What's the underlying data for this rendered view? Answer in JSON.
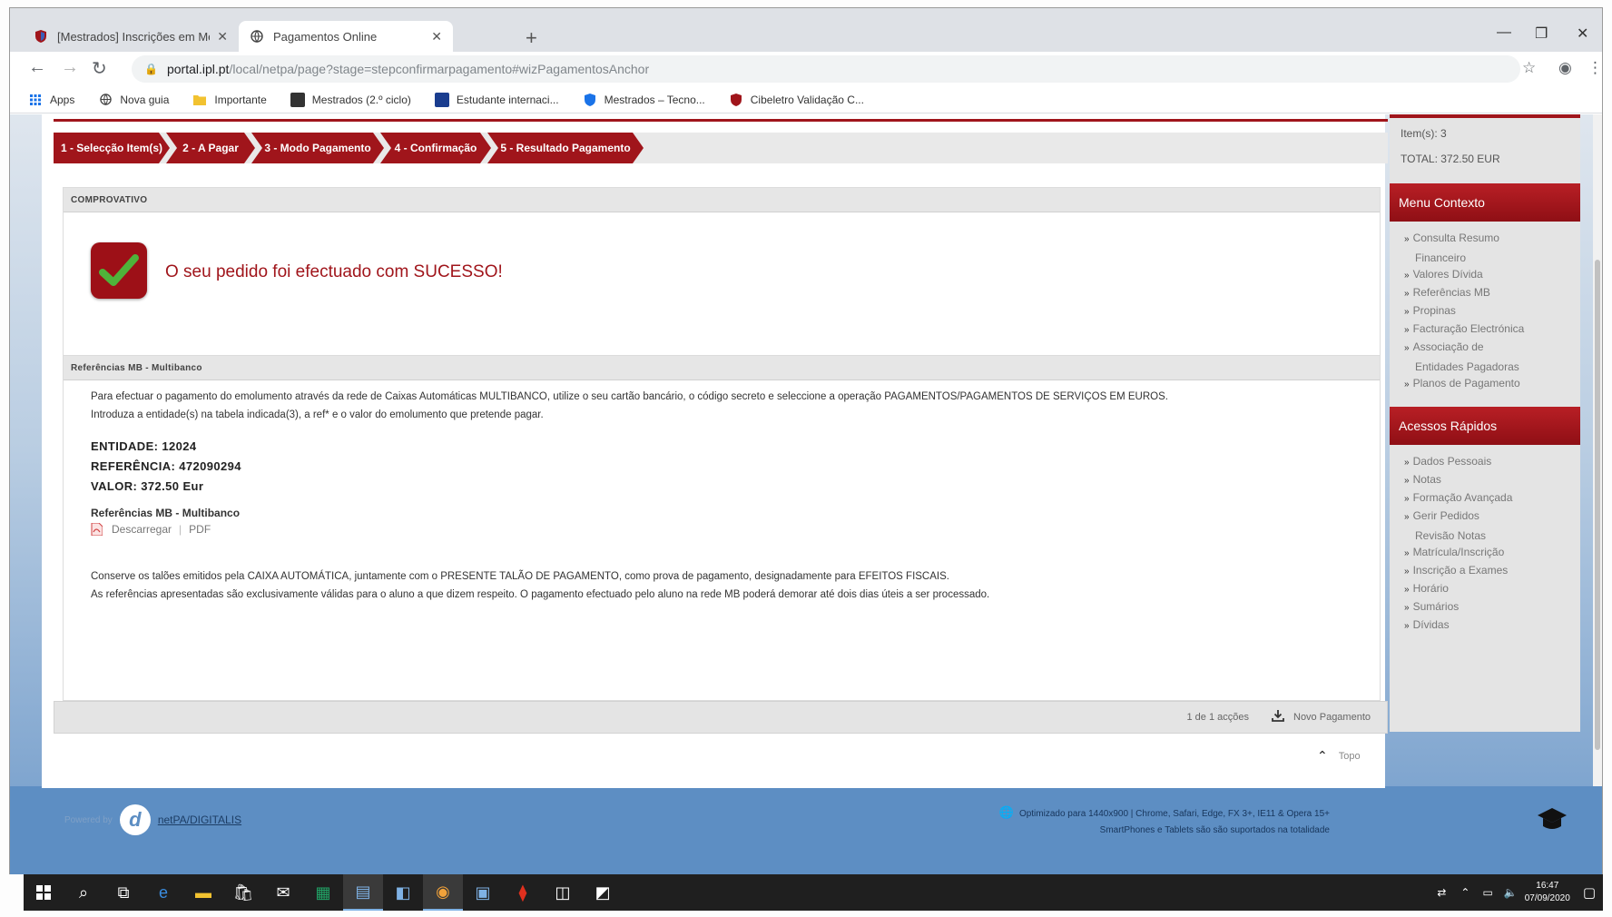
{
  "browser": {
    "tabs": [
      {
        "label": "[Mestrados] Inscrições em Mes…",
        "favicon": "shield-icon",
        "active": false
      },
      {
        "label": "Pagamentos Online",
        "favicon": "globe-icon",
        "active": true
      }
    ],
    "url_host": "portal.ipl.pt",
    "url_path": "/local/netpa/page?stage=stepconfirmarpagamento#wizPagamentosAnchor",
    "bookmarks": [
      {
        "label": "Apps",
        "icon": "apps-grid-icon",
        "color": "#1a73e8"
      },
      {
        "label": "Nova guia",
        "icon": "globe-icon",
        "color": "#555555"
      },
      {
        "label": "Importante",
        "icon": "folder-icon",
        "color": "#f2c230"
      },
      {
        "label": "Mestrados (2.º ciclo)",
        "icon": "bookmark-icon",
        "color": "#333333"
      },
      {
        "label": "Estudante internaci...",
        "icon": "bookmark-icon",
        "color": "#1a3d8f"
      },
      {
        "label": "Mestrados – Tecno...",
        "icon": "shield-icon",
        "color": "#1a73e8"
      },
      {
        "label": "Cibeletro Validação C...",
        "icon": "shield-icon",
        "color": "#a0151b"
      }
    ]
  },
  "wizard": {
    "steps": [
      "1 - Selecção Item(s)",
      "2 - A Pagar",
      "3 - Modo Pagamento",
      "4 - Confirmação",
      "5 - Resultado Pagamento"
    ]
  },
  "comprovativo": {
    "header": "COMPROVATIVO",
    "message": "O seu pedido foi efectuado com SUCESSO!"
  },
  "multibanco": {
    "header": "Referências MB - Multibanco",
    "instruction_line1": "Para efectuar o pagamento do emolumento através da rede de Caixas Automáticas MULTIBANCO, utilize o seu cartão bancário, o código secreto e seleccione a operação PAGAMENTOS/PAGAMENTOS DE SERVIÇOS EM EUROS.",
    "instruction_line2": "Introduza a entidade(s) na tabela indicada(3), a ref* e o valor do emolumento que pretende pagar.",
    "entidade": "ENTIDADE: 12024",
    "referencia": "REFERÊNCIA: 472090294",
    "valor": "VALOR: 372.50 Eur",
    "sublabel": "Referências MB - Multibanco",
    "download_label": "Descarregar",
    "format_label": "PDF",
    "note_line1": "Conserve os talões emitidos pela CAIXA AUTOMÁTICA, juntamente com o PRESENTE TALÃO DE PAGAMENTO, como prova de pagamento, designadamente para EFEITOS FISCAIS.",
    "note_line2": "As referências apresentadas são exclusivamente válidas para o aluno a que dizem respeito. O pagamento efectuado pelo aluno na rede MB poderá demorar até dois dias úteis a ser processado."
  },
  "actions": {
    "count_label": "1 de 1 acções",
    "new_payment": "Novo Pagamento",
    "top_link": "Topo"
  },
  "sidebar": {
    "items_count": "Item(s): 3",
    "total": "TOTAL: 372.50 EUR",
    "menu_header": "Menu Contexto",
    "menu_items": [
      [
        "Consulta Resumo",
        "Financeiro"
      ],
      [
        "Valores Dívida"
      ],
      [
        "Referências MB"
      ],
      [
        "Propinas"
      ],
      [
        "Facturação Electrónica"
      ],
      [
        "Associação de",
        "Entidades Pagadoras"
      ],
      [
        "Planos de Pagamento"
      ]
    ],
    "quick_header": "Acessos Rápidos",
    "quick_items": [
      [
        "Dados Pessoais"
      ],
      [
        "Notas"
      ],
      [
        "Formação Avançada"
      ],
      [
        "Gerir Pedidos",
        "Revisão Notas"
      ],
      [
        "Matrícula/Inscrição"
      ],
      [
        "Inscrição a Exames"
      ],
      [
        "Horário"
      ],
      [
        "Sumários"
      ],
      [
        "Dívidas"
      ]
    ]
  },
  "footer": {
    "powered_label": "Powered by",
    "brand": "netPA/DIGITALIS",
    "note_line1": "Optimizado para 1440x900 | Chrome, Safari, Edge, FX 3+, IE11 & Opera 15+",
    "note_line2": "SmartPhones e Tablets são são suportados na totalidade"
  },
  "taskbar": {
    "clock_time": "16:47",
    "clock_date": "07/09/2020"
  },
  "colors": {
    "brand_red": "#a0151b",
    "page_blue": "#5d8ec3"
  }
}
